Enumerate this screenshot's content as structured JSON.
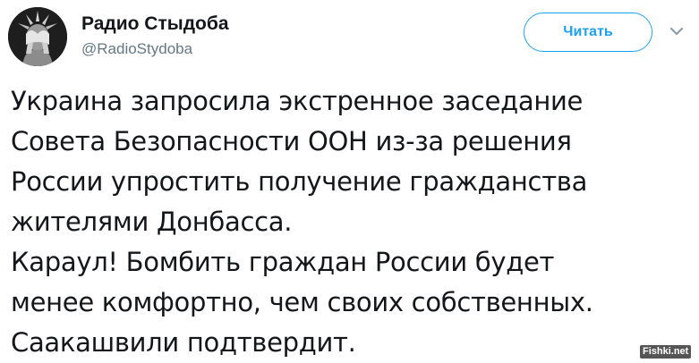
{
  "user": {
    "display_name": "Радио Стыдоба",
    "handle": "@RadioStydoba"
  },
  "follow_button": {
    "label": "Читать",
    "color": "#1da1f2"
  },
  "menu": {
    "icon": "chevron-down-icon"
  },
  "tweet": {
    "lines": [
      "Украина запросила экстренное заседание",
      "Совета Безопасности ООН из-за решения",
      "России упростить получение гражданства",
      "жителями Донбасса.",
      "Караул! Бомбить граждан России будет",
      "менее комфортно, чем своих собственных.",
      "Саакашвили подтвердит."
    ]
  },
  "watermark": {
    "text": "Fishki.net"
  }
}
